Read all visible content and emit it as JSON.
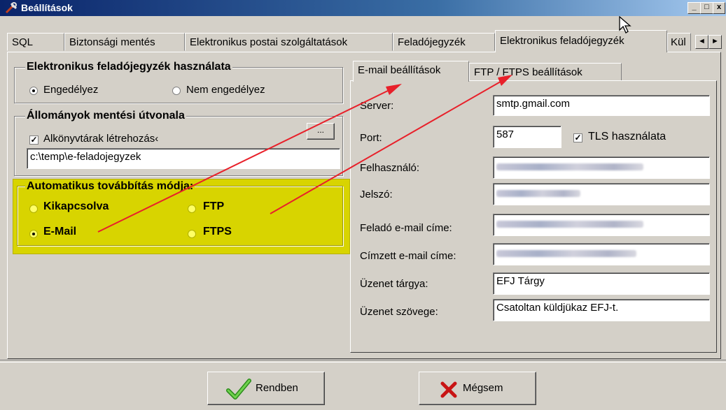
{
  "window": {
    "title": "Beállítások",
    "minimize_label": "_",
    "maximize_label": "□",
    "close_label": "x"
  },
  "tabs": [
    {
      "label": "SQL"
    },
    {
      "label": "Biztonsági mentés"
    },
    {
      "label": "Elektronikus postai szolgáltatások"
    },
    {
      "label": "Feladójegyzék"
    },
    {
      "label": "Elektronikus feladójegyzék"
    },
    {
      "label": "Kül"
    }
  ],
  "tab_scroll": {
    "left": "◄",
    "right": "►"
  },
  "usage_group": {
    "title": "Elektronikus feladójegyzék használata",
    "options": [
      {
        "label": "Engedélyez",
        "selected": true
      },
      {
        "label": "Nem engedélyez",
        "selected": false
      }
    ]
  },
  "path_group": {
    "title": "Állományok mentési útvonala",
    "subdirs_label": "Alkönyvtárak létrehozás‹",
    "subdirs_checked": true,
    "browse_label": "...",
    "path_value": "c:\\temp\\e-feladojegyzek"
  },
  "forward_group": {
    "title": "Automatikus továbbítás módja:",
    "options": [
      {
        "label": "Kikapcsolva",
        "selected": false
      },
      {
        "label": "FTP",
        "selected": false
      },
      {
        "label": "E-Mail",
        "selected": true
      },
      {
        "label": "FTPS",
        "selected": false
      }
    ]
  },
  "inner_tabs": [
    {
      "label": "E-mail beállítások"
    },
    {
      "label": "FTP / FTPS beállítások"
    }
  ],
  "email": {
    "server_label": "Server:",
    "server_value": "smtp.gmail.com",
    "port_label": "Port:",
    "port_value": "587",
    "tls_label": "TLS használata",
    "tls_checked": true,
    "user_label": "Felhasználó:",
    "password_label": "Jelszó:",
    "sender_label": "Feladó e-mail címe:",
    "recipient_label": "Címzett e-mail címe:",
    "subject_label": "Üzenet tárgya:",
    "subject_value": "EFJ Tárgy",
    "body_label": "Üzenet szövege:",
    "body_value": "Csatoltan küldjükaz EFJ-t."
  },
  "buttons": {
    "ok_label": "Rendben",
    "cancel_label": "Mégsem"
  },
  "colors": {
    "highlight": "#d8d400",
    "arrow": "#e8202a",
    "titlebar": "#0a246a"
  }
}
